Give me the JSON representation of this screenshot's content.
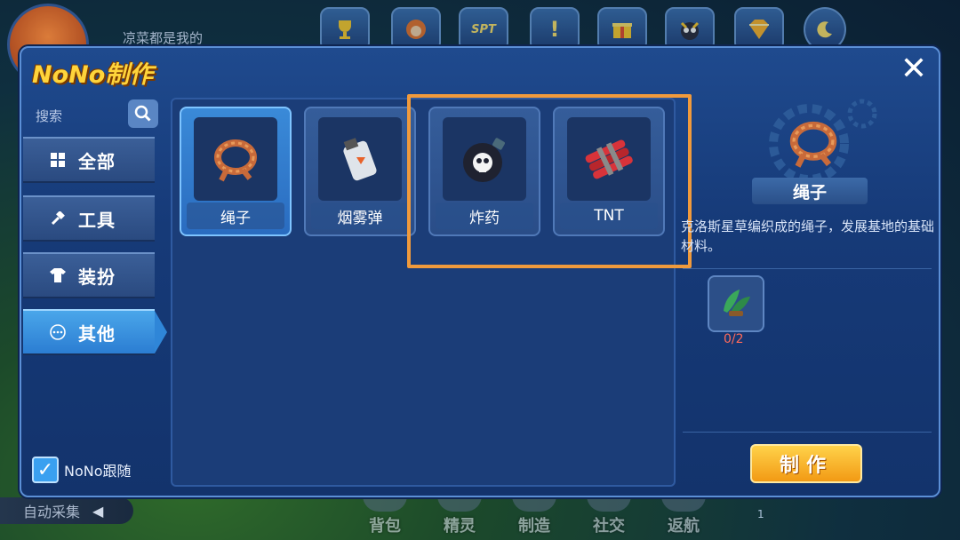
{
  "hud": {
    "player_text": "凉菜都是我的",
    "top_icons": [
      "trophy-icon",
      "monkey-icon",
      "spt-badge-icon",
      "alert-icon",
      "gift-icon",
      "creature-icon",
      "gem-icon",
      "moon-icon"
    ],
    "spt_label": "SPT",
    "alert_label": "!",
    "bottom_nav": [
      "背包",
      "精灵",
      "制造",
      "社交",
      "返航"
    ],
    "auto_collect": "自动采集",
    "minimap_count": "1"
  },
  "panel": {
    "title": "NoNo制作",
    "close_symbol": "✕",
    "search_label": "搜索",
    "tabs": [
      {
        "label": "全部",
        "icon": "grid-icon",
        "active": false
      },
      {
        "label": "工具",
        "icon": "hammer-icon",
        "active": false
      },
      {
        "label": "装扮",
        "icon": "shirt-icon",
        "active": false
      },
      {
        "label": "其他",
        "icon": "more-icon",
        "active": true
      }
    ],
    "follow_label": "NoNo跟随",
    "follow_checked": true
  },
  "items": [
    {
      "name": "绳子",
      "icon": "rope-icon",
      "selected": true
    },
    {
      "name": "烟雾弹",
      "icon": "smoke-bomb-icon",
      "selected": false
    },
    {
      "name": "炸药",
      "icon": "skull-bomb-icon",
      "selected": false
    },
    {
      "name": "TNT",
      "icon": "dynamite-icon",
      "selected": false
    }
  ],
  "detail": {
    "name": "绳子",
    "description": "克洛斯星草编织成的绳子，发展基地的基础材料。",
    "material_icon": "grass-bundle-icon",
    "material_count": "0/2",
    "craft_button": "制作"
  },
  "colors": {
    "title": "#ffd43b",
    "highlight": "#f09a3c",
    "craft_button": "#f29a14",
    "material_count": "#ff6a5a"
  }
}
